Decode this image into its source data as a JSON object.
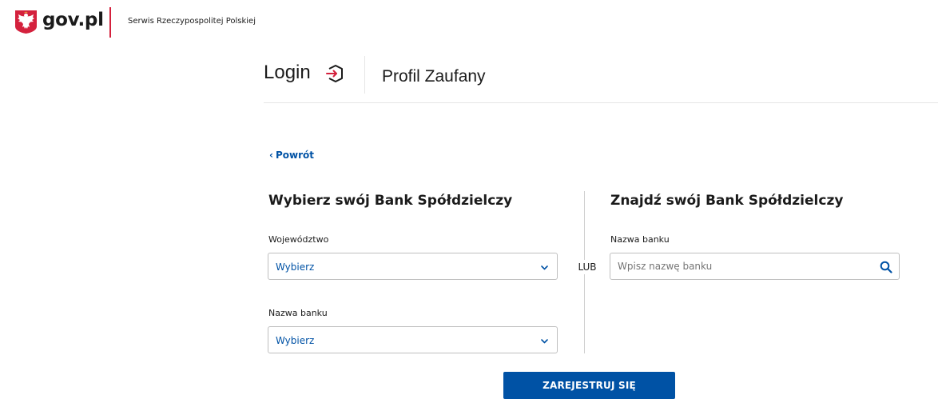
{
  "topbar": {
    "logo_text": "gov.pl",
    "service_name": "Serwis Rzeczypospolitej Polskiej"
  },
  "header": {
    "login_word": "Login",
    "title": "Profil Zaufany"
  },
  "back_link": {
    "label": "Powrót"
  },
  "left_section": {
    "title": "Wybierz swój Bank Spółdzielczy",
    "province_label": "Województwo",
    "province_value": "Wybierz",
    "bank_label": "Nazwa banku",
    "bank_value": "Wybierz"
  },
  "separator_text": "LUB",
  "right_section": {
    "title": "Znajdź swój Bank Spółdzielczy",
    "bank_label": "Nazwa banku",
    "search_placeholder": "Wpisz nazwę banku",
    "search_value": ""
  },
  "register_button": {
    "label": "ZAREJESTRUJ SIĘ"
  },
  "icons": {
    "emblem": "polish-eagle-emblem-icon",
    "login": "login-door-icon",
    "back": "chevron-left-icon",
    "dropdown": "chevron-down-icon",
    "search": "search-icon"
  },
  "colors": {
    "accent_blue": "#0052a5",
    "gov_red": "#d4213d",
    "text": "#1b1b1b"
  }
}
